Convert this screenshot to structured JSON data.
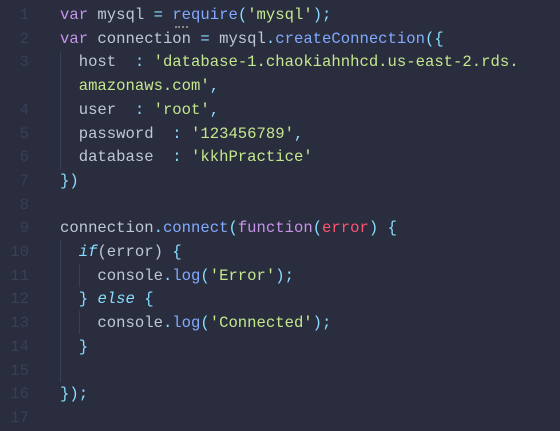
{
  "editor": {
    "colors": {
      "background": "#292d3e",
      "line_number": "#3a3f58",
      "text": "#bfc7d5",
      "keyword": "#c792ea",
      "control": "#89ddff",
      "punctuation": "#89ddff",
      "function": "#82aaff",
      "string": "#c3e88d",
      "parameter": "#ff5370"
    },
    "rows": [
      {
        "n": "1",
        "tokens": [
          [
            "kw",
            "var"
          ],
          [
            "text",
            " mysql "
          ],
          [
            "punc",
            "="
          ],
          [
            "text",
            " "
          ],
          [
            "fn",
            "require"
          ],
          [
            "punc",
            "("
          ],
          [
            "str",
            "'mysql'"
          ],
          [
            "punc",
            ");"
          ]
        ]
      },
      {
        "n": "2",
        "tokens": [
          [
            "kw",
            "var"
          ],
          [
            "text",
            " connection "
          ],
          [
            "punc",
            "="
          ],
          [
            "text",
            " mysql"
          ],
          [
            "punc",
            "."
          ],
          [
            "fn",
            "createConnection"
          ],
          [
            "punc",
            "({"
          ]
        ]
      },
      {
        "n": "3",
        "tokens": [
          [
            "text",
            "  host  "
          ],
          [
            "punc",
            ":"
          ],
          [
            "text",
            " "
          ],
          [
            "str",
            "'database-1.chaokiahnhcd.us-east-2.rds."
          ]
        ]
      },
      {
        "n": "",
        "tokens": [
          [
            "str",
            "  amazonaws.com'"
          ],
          [
            "punc",
            ","
          ]
        ]
      },
      {
        "n": "4",
        "tokens": [
          [
            "text",
            "  user  "
          ],
          [
            "punc",
            ":"
          ],
          [
            "text",
            " "
          ],
          [
            "str",
            "'root'"
          ],
          [
            "punc",
            ","
          ]
        ]
      },
      {
        "n": "5",
        "tokens": [
          [
            "text",
            "  password  "
          ],
          [
            "punc",
            ":"
          ],
          [
            "text",
            " "
          ],
          [
            "str",
            "'123456789'"
          ],
          [
            "punc",
            ","
          ]
        ]
      },
      {
        "n": "6",
        "tokens": [
          [
            "text",
            "  database  "
          ],
          [
            "punc",
            ":"
          ],
          [
            "text",
            " "
          ],
          [
            "str",
            "'kkhPractice'"
          ]
        ]
      },
      {
        "n": "7",
        "tokens": [
          [
            "punc",
            "})"
          ]
        ]
      },
      {
        "n": "8",
        "tokens": []
      },
      {
        "n": "9",
        "tokens": [
          [
            "text",
            "connection"
          ],
          [
            "punc",
            "."
          ],
          [
            "fn",
            "connect"
          ],
          [
            "punc",
            "("
          ],
          [
            "kw",
            "function"
          ],
          [
            "punc",
            "("
          ],
          [
            "param",
            "error"
          ],
          [
            "punc",
            ")"
          ],
          [
            "text",
            " "
          ],
          [
            "punc",
            "{"
          ]
        ]
      },
      {
        "n": "10",
        "tokens": [
          [
            "text",
            "  "
          ],
          [
            "ctl",
            "if"
          ],
          [
            "text",
            "(error) "
          ],
          [
            "punc",
            "{"
          ]
        ]
      },
      {
        "n": "11",
        "tokens": [
          [
            "text",
            "    console"
          ],
          [
            "punc",
            "."
          ],
          [
            "fn",
            "log"
          ],
          [
            "punc",
            "("
          ],
          [
            "str",
            "'Error'"
          ],
          [
            "punc",
            ");"
          ]
        ]
      },
      {
        "n": "12",
        "tokens": [
          [
            "text",
            "  "
          ],
          [
            "punc",
            "}"
          ],
          [
            "text",
            " "
          ],
          [
            "ctl",
            "else"
          ],
          [
            "text",
            " "
          ],
          [
            "punc",
            "{"
          ]
        ]
      },
      {
        "n": "13",
        "tokens": [
          [
            "text",
            "    console"
          ],
          [
            "punc",
            "."
          ],
          [
            "fn",
            "log"
          ],
          [
            "punc",
            "("
          ],
          [
            "str",
            "'Connected'"
          ],
          [
            "punc",
            ");"
          ]
        ]
      },
      {
        "n": "14",
        "tokens": [
          [
            "text",
            "  "
          ],
          [
            "punc",
            "}"
          ]
        ]
      },
      {
        "n": "15",
        "tokens": []
      },
      {
        "n": "16",
        "tokens": [
          [
            "punc",
            "});"
          ]
        ]
      },
      {
        "n": "17",
        "tokens": []
      }
    ]
  }
}
